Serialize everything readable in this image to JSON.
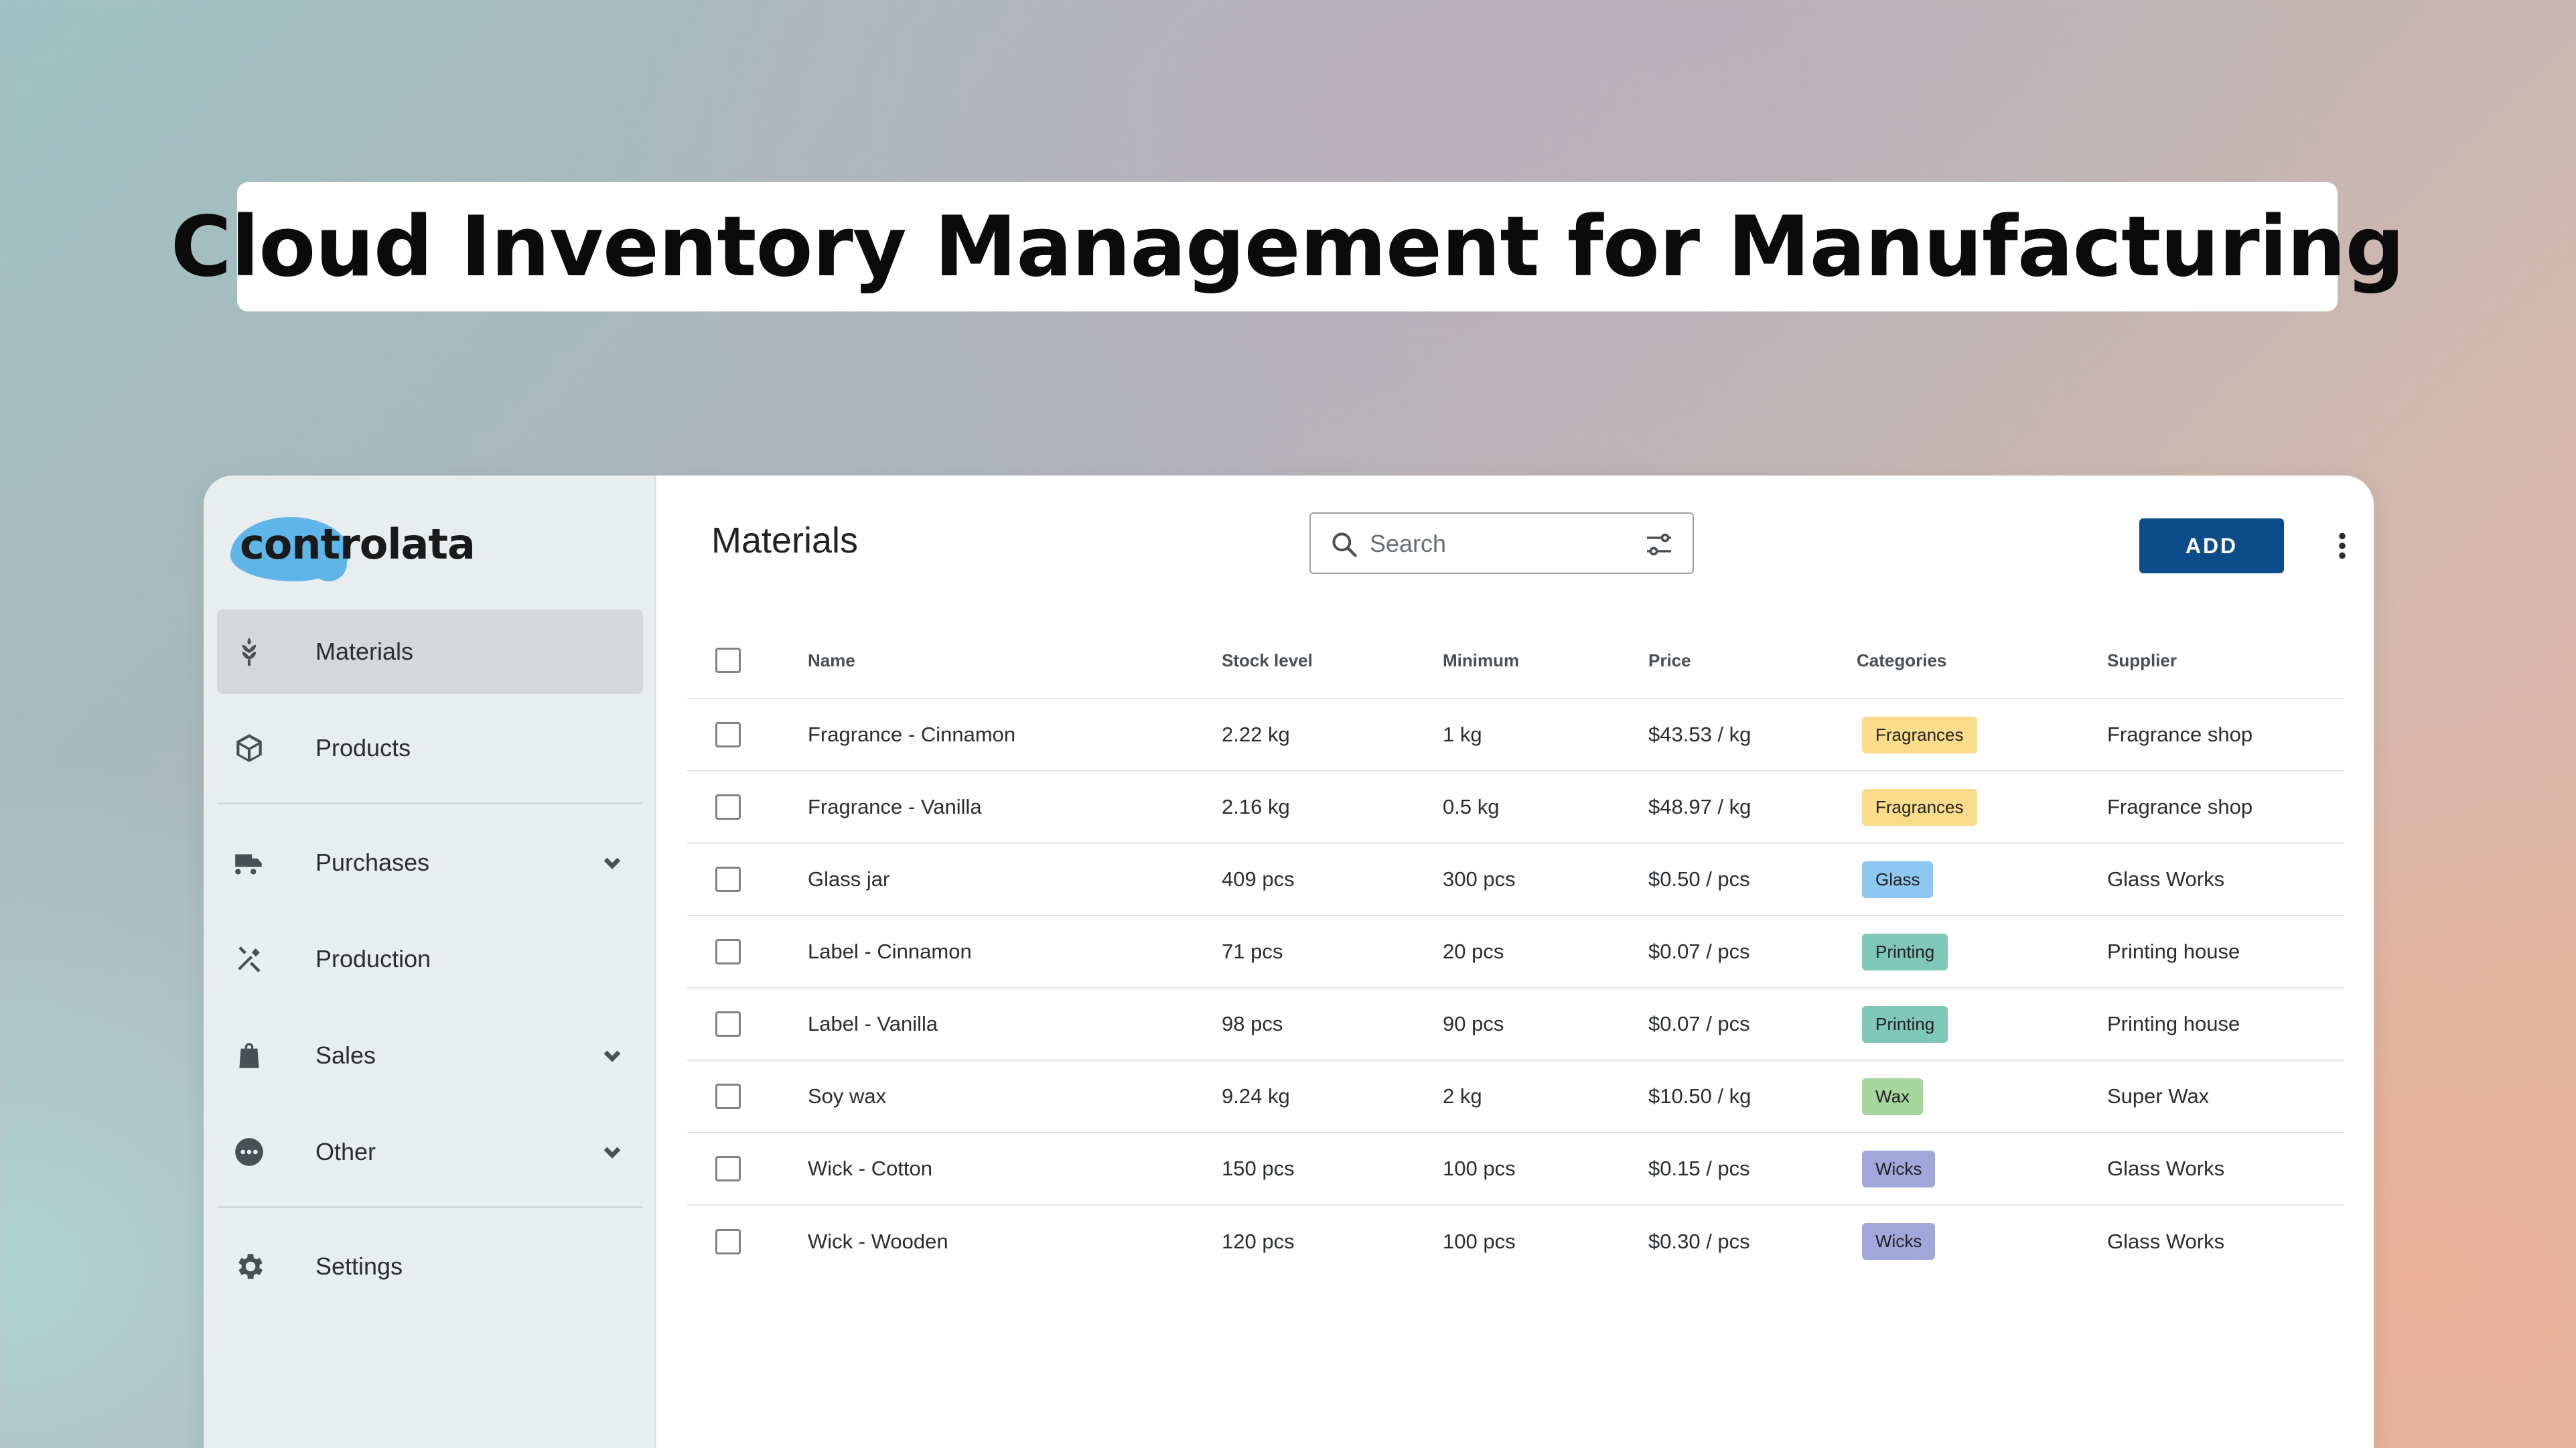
{
  "banner": {
    "title": "Cloud Inventory Management for Manufacturing"
  },
  "app": {
    "logo_text": "controlata"
  },
  "sidebar": {
    "items": [
      {
        "label": "Materials",
        "icon": "wheat-icon",
        "active": true,
        "expandable": false
      },
      {
        "label": "Products",
        "icon": "box-icon",
        "active": false,
        "expandable": false
      },
      {
        "label": "Purchases",
        "icon": "truck-icon",
        "active": false,
        "expandable": true
      },
      {
        "label": "Production",
        "icon": "tools-icon",
        "active": false,
        "expandable": false
      },
      {
        "label": "Sales",
        "icon": "shopping-bag-icon",
        "active": false,
        "expandable": true
      },
      {
        "label": "Other",
        "icon": "more-horizontal-circle-icon",
        "active": false,
        "expandable": true
      },
      {
        "label": "Settings",
        "icon": "gear-icon",
        "active": false,
        "expandable": false
      }
    ]
  },
  "header": {
    "page_title": "Materials",
    "search_placeholder": "Search",
    "add_label": "ADD"
  },
  "table": {
    "columns": [
      "Name",
      "Stock level",
      "Minimum",
      "Price",
      "Categories",
      "Supplier"
    ],
    "rows": [
      {
        "name": "Fragrance - Cinnamon",
        "stock": "2.22 kg",
        "minimum": "1 kg",
        "price": "$43.53 / kg",
        "category": "Fragrances",
        "category_color": "#fadc8b",
        "supplier": "Fragrance shop"
      },
      {
        "name": "Fragrance - Vanilla",
        "stock": "2.16 kg",
        "minimum": "0.5 kg",
        "price": "$48.97 / kg",
        "category": "Fragrances",
        "category_color": "#fadc8b",
        "supplier": "Fragrance shop"
      },
      {
        "name": "Glass jar",
        "stock": "409 pcs",
        "minimum": "300 pcs",
        "price": "$0.50 / pcs",
        "category": "Glass",
        "category_color": "#8ec7f1",
        "supplier": "Glass Works"
      },
      {
        "name": "Label - Cinnamon",
        "stock": "71 pcs",
        "minimum": "20 pcs",
        "price": "$0.07 / pcs",
        "category": "Printing",
        "category_color": "#7fc7b7",
        "supplier": "Printing house"
      },
      {
        "name": "Label - Vanilla",
        "stock": "98 pcs",
        "minimum": "90 pcs",
        "price": "$0.07 / pcs",
        "category": "Printing",
        "category_color": "#7fc7b7",
        "supplier": "Printing house"
      },
      {
        "name": "Soy wax",
        "stock": "9.24 kg",
        "minimum": "2 kg",
        "price": "$10.50 / kg",
        "category": "Wax",
        "category_color": "#a6d59d",
        "supplier": "Super Wax"
      },
      {
        "name": "Wick - Cotton",
        "stock": "150 pcs",
        "minimum": "100 pcs",
        "price": "$0.15 / pcs",
        "category": "Wicks",
        "category_color": "#a2a7db",
        "supplier": "Glass Works"
      },
      {
        "name": "Wick - Wooden",
        "stock": "120 pcs",
        "minimum": "100 pcs",
        "price": "$0.30 / pcs",
        "category": "Wicks",
        "category_color": "#a2a7db",
        "supplier": "Glass Works"
      }
    ]
  },
  "colors": {
    "accent": "#0d4c8b",
    "logo_blob": "#5fb5e8",
    "sidebar_bg": "#e8edf0"
  }
}
